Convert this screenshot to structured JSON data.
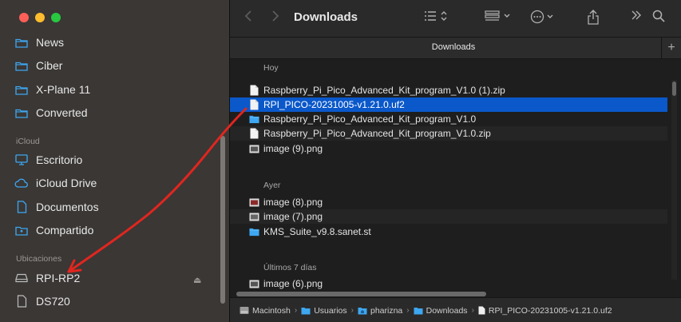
{
  "sidebar": {
    "favorites": [
      {
        "label": "News"
      },
      {
        "label": "Ciber"
      },
      {
        "label": "X-Plane 11"
      },
      {
        "label": "Converted"
      }
    ],
    "icloud_header": "iCloud",
    "icloud": [
      {
        "label": "Escritorio"
      },
      {
        "label": "iCloud Drive"
      },
      {
        "label": "Documentos"
      },
      {
        "label": "Compartido"
      }
    ],
    "locations_header": "Ubicaciones",
    "locations": [
      {
        "label": "RPI-RP2"
      },
      {
        "label": "DS720"
      }
    ]
  },
  "toolbar": {
    "title": "Downloads"
  },
  "tabbar": {
    "label": "Downloads",
    "new_tab": "+"
  },
  "groups": [
    {
      "header": "Hoy",
      "files": [
        {
          "name": "Raspberry_Pi_Pico_Advanced_Kit_program_V1.0 (1).zip",
          "kind": "document"
        },
        {
          "name": "RPI_PICO-20231005-v1.21.0.uf2",
          "kind": "document",
          "selected": true
        },
        {
          "name": "Raspberry_Pi_Pico_Advanced_Kit_program_V1.0",
          "kind": "folder"
        },
        {
          "name": "Raspberry_Pi_Pico_Advanced_Kit_program_V1.0.zip",
          "kind": "document"
        },
        {
          "name": "image (9).png",
          "kind": "image"
        }
      ]
    },
    {
      "header": "Ayer",
      "files": [
        {
          "name": "image (8).png",
          "kind": "image"
        },
        {
          "name": "image (7).png",
          "kind": "image"
        },
        {
          "name": "KMS_Suite_v9.8.sanet.st",
          "kind": "folder"
        }
      ]
    },
    {
      "header": "Últimos 7 días",
      "files": [
        {
          "name": "image (6).png",
          "kind": "image"
        }
      ]
    }
  ],
  "pathbar": [
    {
      "label": "Macintosh",
      "icon": "disk-icon"
    },
    {
      "label": "Usuarios",
      "icon": "folder-icon"
    },
    {
      "label": "pharizna",
      "icon": "home-folder-icon"
    },
    {
      "label": "Downloads",
      "icon": "folder-icon"
    },
    {
      "label": "RPI_PICO-20231005-v1.21.0.uf2",
      "icon": "document-icon"
    }
  ],
  "colors": {
    "selection": "#0a58ca",
    "folder_blue": "#3ea7f1",
    "annotation_red": "#e0261f"
  }
}
